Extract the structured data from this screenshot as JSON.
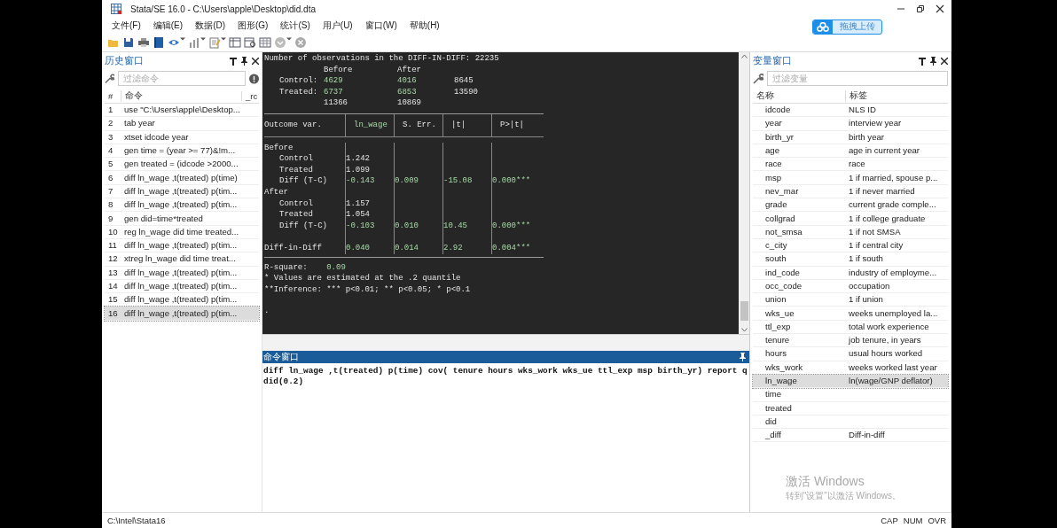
{
  "window": {
    "title": "Stata/SE 16.0 - C:\\Users\\apple\\Desktop\\did.dta"
  },
  "menu": [
    "文件(F)",
    "编辑(E)",
    "数据(D)",
    "图形(G)",
    "统计(S)",
    "用户(U)",
    "窗口(W)",
    "帮助(H)"
  ],
  "upload_button": {
    "label": "拖拽上传"
  },
  "history": {
    "title": "历史窗口",
    "filter_placeholder": "过滤命令",
    "columns": [
      "#",
      "命令",
      "_rc"
    ],
    "rows": [
      {
        "num": "1",
        "command": "use \"C:\\Users\\apple\\Desktop...",
        "selected": false
      },
      {
        "num": "2",
        "command": "tab year",
        "selected": false
      },
      {
        "num": "3",
        "command": "xtset idcode year",
        "selected": false
      },
      {
        "num": "4",
        "command": "gen time = (year >= 77)&!m...",
        "selected": false
      },
      {
        "num": "5",
        "command": "gen treated = (idcode >2000...",
        "selected": false
      },
      {
        "num": "6",
        "command": "diff ln_wage ,t(treated) p(time)",
        "selected": false
      },
      {
        "num": "7",
        "command": "diff ln_wage ,t(treated) p(tim...",
        "selected": false
      },
      {
        "num": "8",
        "command": "diff ln_wage ,t(treated) p(tim...",
        "selected": false
      },
      {
        "num": "9",
        "command": "gen did=time*treated",
        "selected": false
      },
      {
        "num": "10",
        "command": "reg ln_wage did time treated...",
        "selected": false
      },
      {
        "num": "11",
        "command": "diff ln_wage ,t(treated) p(tim...",
        "selected": false
      },
      {
        "num": "12",
        "command": "xtreg ln_wage  did time treat...",
        "selected": false
      },
      {
        "num": "13",
        "command": "diff ln_wage ,t(treated) p(tim...",
        "selected": false
      },
      {
        "num": "14",
        "command": "diff ln_wage ,t(treated) p(tim...",
        "selected": false
      },
      {
        "num": "15",
        "command": "diff ln_wage ,t(treated) p(tim...",
        "selected": false
      },
      {
        "num": "16",
        "command": "diff ln_wage ,t(treated) p(tim...",
        "selected": true
      }
    ]
  },
  "results": {
    "summary": "Number of observations in the DIFF-IN-DIFF: 22235",
    "counts": {
      "columns": [
        "Before",
        "After"
      ],
      "rows": [
        {
          "label": "Control:",
          "values": [
            {
              "text": "4629",
              "kind": "result"
            },
            {
              "text": "4016",
              "kind": "result"
            },
            {
              "text": "8645",
              "kind": "text"
            }
          ]
        },
        {
          "label": "Treated:",
          "values": [
            {
              "text": "6737",
              "kind": "result"
            },
            {
              "text": "6853",
              "kind": "result"
            },
            {
              "text": "13590",
              "kind": "text"
            }
          ]
        },
        {
          "label": "",
          "values": [
            {
              "text": "11366",
              "kind": "text"
            },
            {
              "text": "10869",
              "kind": "text"
            }
          ]
        }
      ]
    },
    "table": {
      "columns": [
        {
          "text": "Outcome var.",
          "kind": "text"
        },
        {
          "text": "ln_wage",
          "kind": "result"
        },
        {
          "text": "S. Err.",
          "kind": "text"
        },
        {
          "text": "|t|",
          "kind": "text"
        },
        {
          "text": "P>|t|",
          "kind": "text"
        }
      ],
      "rows": [
        {
          "label": "Before",
          "kind": "group",
          "values": []
        },
        {
          "label": "Control",
          "kind": "item",
          "values": [
            {
              "text": "1.242",
              "kind": "text"
            }
          ]
        },
        {
          "label": "Treated",
          "kind": "item",
          "values": [
            {
              "text": "1.099",
              "kind": "text"
            }
          ]
        },
        {
          "label": "Diff (T-C)",
          "kind": "item",
          "values": [
            {
              "text": "-0.143",
              "kind": "result"
            },
            {
              "text": "0.009",
              "kind": "result"
            },
            {
              "text": "-15.08",
              "kind": "result"
            },
            {
              "text": "0.000***",
              "kind": "result"
            }
          ]
        },
        {
          "label": "After",
          "kind": "group",
          "values": []
        },
        {
          "label": "Control",
          "kind": "item",
          "values": [
            {
              "text": "1.157",
              "kind": "text"
            }
          ]
        },
        {
          "label": "Treated",
          "kind": "item",
          "values": [
            {
              "text": "1.054",
              "kind": "text"
            }
          ]
        },
        {
          "label": "Diff (T-C)",
          "kind": "item",
          "values": [
            {
              "text": "-0.103",
              "kind": "result"
            },
            {
              "text": "0.010",
              "kind": "result"
            },
            {
              "text": "10.45",
              "kind": "result"
            },
            {
              "text": "0.000***",
              "kind": "result"
            }
          ]
        },
        {
          "label": "Diff-in-Diff",
          "kind": "total",
          "values": [
            {
              "text": "0.040",
              "kind": "result"
            },
            {
              "text": "0.014",
              "kind": "result"
            },
            {
              "text": "2.92",
              "kind": "result"
            },
            {
              "text": "0.004***",
              "kind": "result"
            }
          ]
        }
      ]
    },
    "footer": [
      [
        {
          "text": "R-square:    ",
          "kind": "text"
        },
        {
          "text": "0.09",
          "kind": "result"
        }
      ],
      [
        {
          "text": "* Values are estimated at the .2 quantile",
          "kind": "text"
        }
      ],
      [
        {
          "text": "**Inference: *** p<0.01; ** p<0.05; * p<0.1",
          "kind": "text"
        }
      ]
    ],
    "prompt": "."
  },
  "command": {
    "title": "命令窗口",
    "text": "diff ln_wage ,t(treated) p(time) cov( tenure hours wks_work wks_ue ttl_exp msp birth_yr) report q did(0.2)"
  },
  "variables": {
    "title": "变量窗口",
    "filter_placeholder": "过滤变量",
    "columns": [
      "名称",
      "标签"
    ],
    "rows": [
      {
        "name": "idcode",
        "label": "NLS ID",
        "selected": false
      },
      {
        "name": "year",
        "label": "interview year",
        "selected": false
      },
      {
        "name": "birth_yr",
        "label": "birth year",
        "selected": false
      },
      {
        "name": "age",
        "label": "age in current year",
        "selected": false
      },
      {
        "name": "race",
        "label": "race",
        "selected": false
      },
      {
        "name": "msp",
        "label": "1 if married, spouse p...",
        "selected": false
      },
      {
        "name": "nev_mar",
        "label": "1 if never married",
        "selected": false
      },
      {
        "name": "grade",
        "label": "current grade comple...",
        "selected": false
      },
      {
        "name": "collgrad",
        "label": "1 if college graduate",
        "selected": false
      },
      {
        "name": "not_smsa",
        "label": "1 if not SMSA",
        "selected": false
      },
      {
        "name": "c_city",
        "label": "1 if central city",
        "selected": false
      },
      {
        "name": "south",
        "label": "1 if south",
        "selected": false
      },
      {
        "name": "ind_code",
        "label": "industry of employme...",
        "selected": false
      },
      {
        "name": "occ_code",
        "label": "occupation",
        "selected": false
      },
      {
        "name": "union",
        "label": "1 if union",
        "selected": false
      },
      {
        "name": "wks_ue",
        "label": "weeks unemployed la...",
        "selected": false
      },
      {
        "name": "ttl_exp",
        "label": "total work experience",
        "selected": false
      },
      {
        "name": "tenure",
        "label": "job tenure, in years",
        "selected": false
      },
      {
        "name": "hours",
        "label": "usual hours worked",
        "selected": false
      },
      {
        "name": "wks_work",
        "label": "weeks worked last year",
        "selected": false
      },
      {
        "name": "ln_wage",
        "label": "ln(wage/GNP deflator)",
        "selected": true
      },
      {
        "name": "time",
        "label": "",
        "selected": false
      },
      {
        "name": "treated",
        "label": "",
        "selected": false
      },
      {
        "name": "did",
        "label": "",
        "selected": false
      },
      {
        "name": "_diff",
        "label": "Diff-in-diff",
        "selected": false
      }
    ]
  },
  "activation": {
    "title": "激活 Windows",
    "subtitle": "转到“设置”以激活 Windows。"
  },
  "status_bar": {
    "path": "C:\\Intel\\Stata16",
    "indicators": [
      "CAP",
      "NUM",
      "OVR"
    ]
  }
}
